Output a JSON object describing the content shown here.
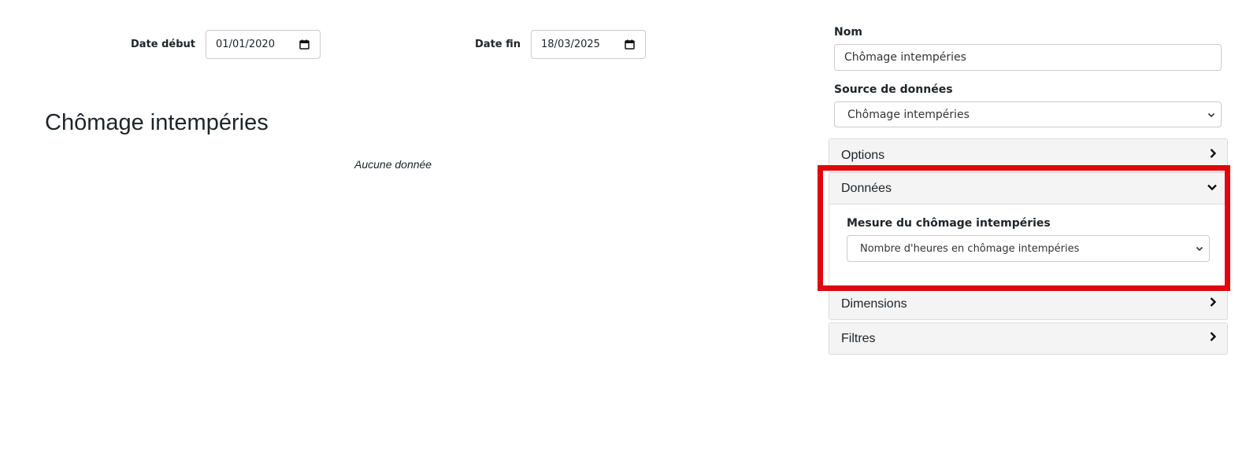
{
  "filters": {
    "start_date_label": "Date début",
    "start_date_value": "01/01/2020",
    "end_date_label": "Date fin",
    "end_date_value": "18/03/2025"
  },
  "chart": {
    "title": "Chômage intempéries",
    "empty_message": "Aucune donnée"
  },
  "sidebar": {
    "name_label": "Nom",
    "name_value": "Chômage intempéries",
    "source_label": "Source de données",
    "source_value": "Chômage intempéries",
    "panels": [
      {
        "title": "Options",
        "expanded": false
      },
      {
        "title": "Données",
        "expanded": true,
        "field_label": "Mesure du chômage intempéries",
        "field_value": "Nombre d'heures en chômage intempéries"
      },
      {
        "title": "Dimensions",
        "expanded": false
      },
      {
        "title": "Filtres",
        "expanded": false
      }
    ]
  },
  "colors": {
    "highlight": "#e0070b",
    "panel_header_bg": "#f4f4f4",
    "border": "#c7cbd0"
  },
  "icons": {
    "calendar": "calendar-icon",
    "collapsed": "chevron-right-icon",
    "expanded": "chevron-down-icon",
    "select": "chevron-down-icon"
  }
}
